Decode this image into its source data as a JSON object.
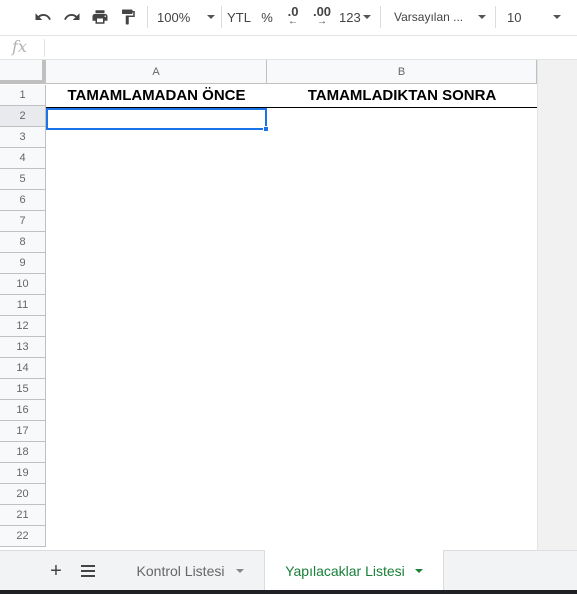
{
  "toolbar": {
    "undo_icon": "undo-icon",
    "redo_icon": "redo-icon",
    "print_icon": "print-icon",
    "paint_format_icon": "paint-format-icon",
    "zoom": "100%",
    "currency": "YTL",
    "percent": "%",
    "decrease_decimal": ".0",
    "increase_decimal": ".00",
    "more_formats": "123",
    "font": "Varsayılan ...",
    "font_size": "10"
  },
  "formula_bar": {
    "fx_label": "fx",
    "value": ""
  },
  "grid": {
    "columns": [
      "A",
      "B"
    ],
    "rows": [
      "1",
      "2",
      "3",
      "4",
      "5",
      "6",
      "7",
      "8",
      "9",
      "10",
      "11",
      "12",
      "13",
      "14",
      "15",
      "16",
      "17",
      "18",
      "19",
      "20",
      "21",
      "22"
    ],
    "cells": {
      "A1": "TAMAMLAMADAN ÖNCE",
      "B1": "TAMAMLADIKTAN SONRA"
    },
    "selected_cell": "A2"
  },
  "sheet_tabs": {
    "add_icon": "plus-icon",
    "list_icon": "sheet-list-icon",
    "tabs": [
      {
        "label": "Kontrol Listesi",
        "active": false
      },
      {
        "label": "Yapılacaklar Listesi",
        "active": true
      }
    ]
  },
  "colors": {
    "active_tab": "#188038",
    "selection": "#1a73e8",
    "header_bg": "#f8f9fa"
  }
}
